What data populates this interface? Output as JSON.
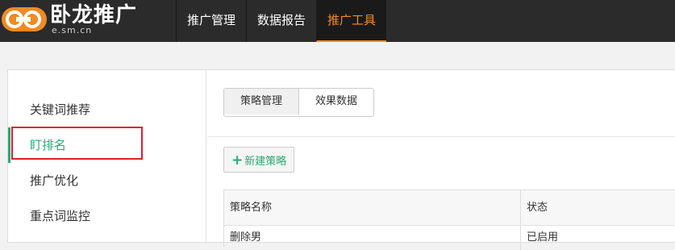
{
  "header": {
    "logo_title": "卧龙推广",
    "logo_subtitle": "e.sm.cn",
    "brand_color": "#f08a24",
    "nav": [
      {
        "label": "推广管理"
      },
      {
        "label": "数据报告"
      },
      {
        "label": "推广工具",
        "active": true
      }
    ]
  },
  "sidebar": {
    "accent_color": "#2aa876",
    "items": [
      {
        "label": "关键词推荐"
      },
      {
        "label": "盯排名",
        "active": true
      },
      {
        "label": "推广优化"
      },
      {
        "label": "重点词监控"
      }
    ]
  },
  "main": {
    "tabs": [
      {
        "label": "策略管理",
        "active": true
      },
      {
        "label": "效果数据"
      }
    ],
    "new_button": {
      "icon": "plus-icon",
      "label": "新建策略"
    },
    "table": {
      "columns": [
        "策略名称",
        "状态"
      ],
      "rows": [
        [
          "删除男",
          "已启用"
        ]
      ]
    }
  }
}
